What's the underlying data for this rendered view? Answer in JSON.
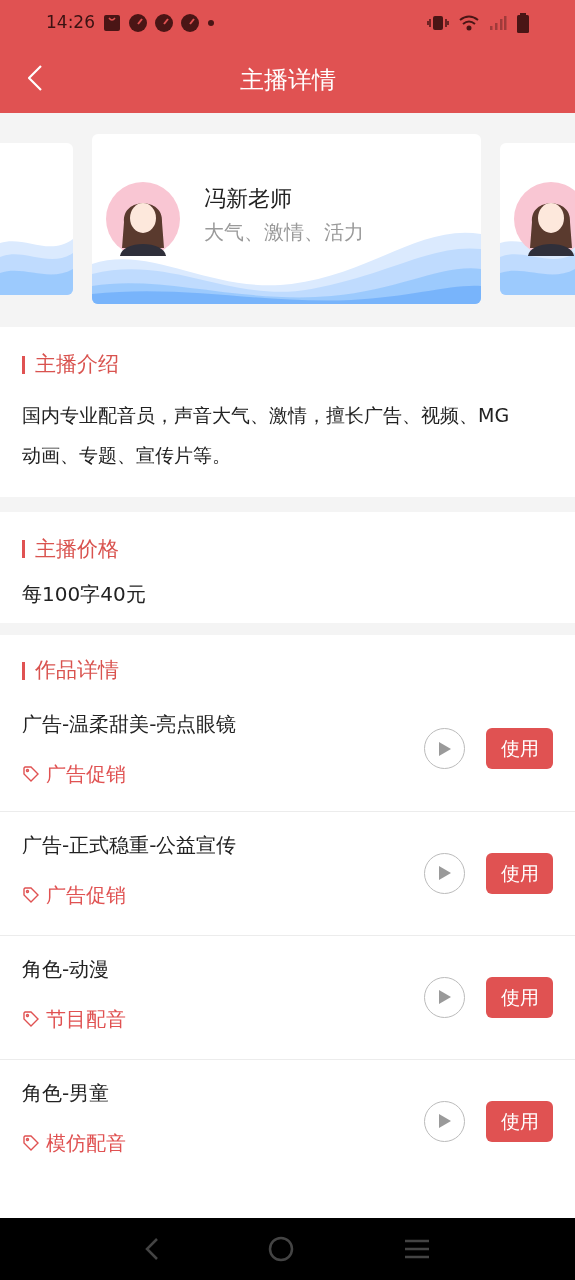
{
  "status_bar": {
    "time": "14:26"
  },
  "header": {
    "title": "主播详情"
  },
  "anchors": [
    {
      "selected": false
    },
    {
      "selected": true,
      "name": "冯新老师",
      "tags": "大气、激情、活力"
    },
    {
      "selected": false
    }
  ],
  "intro": {
    "title": "主播介绍",
    "text": "国内专业配音员，声音大气、激情，擅长广告、视频、MG动画、专题、宣传片等。"
  },
  "price": {
    "title": "主播价格",
    "text": "每100字40元"
  },
  "works": {
    "title": "作品详情",
    "items": [
      {
        "title": "广告-温柔甜美-亮点眼镜",
        "tag": "广告促销",
        "button": "使用"
      },
      {
        "title": "广告-正式稳重-公益宣传",
        "tag": "广告促销",
        "button": "使用"
      },
      {
        "title": "角色-动漫",
        "tag": "节目配音",
        "button": "使用"
      },
      {
        "title": "角色-男童",
        "tag": "模仿配音",
        "button": "使用"
      }
    ]
  }
}
